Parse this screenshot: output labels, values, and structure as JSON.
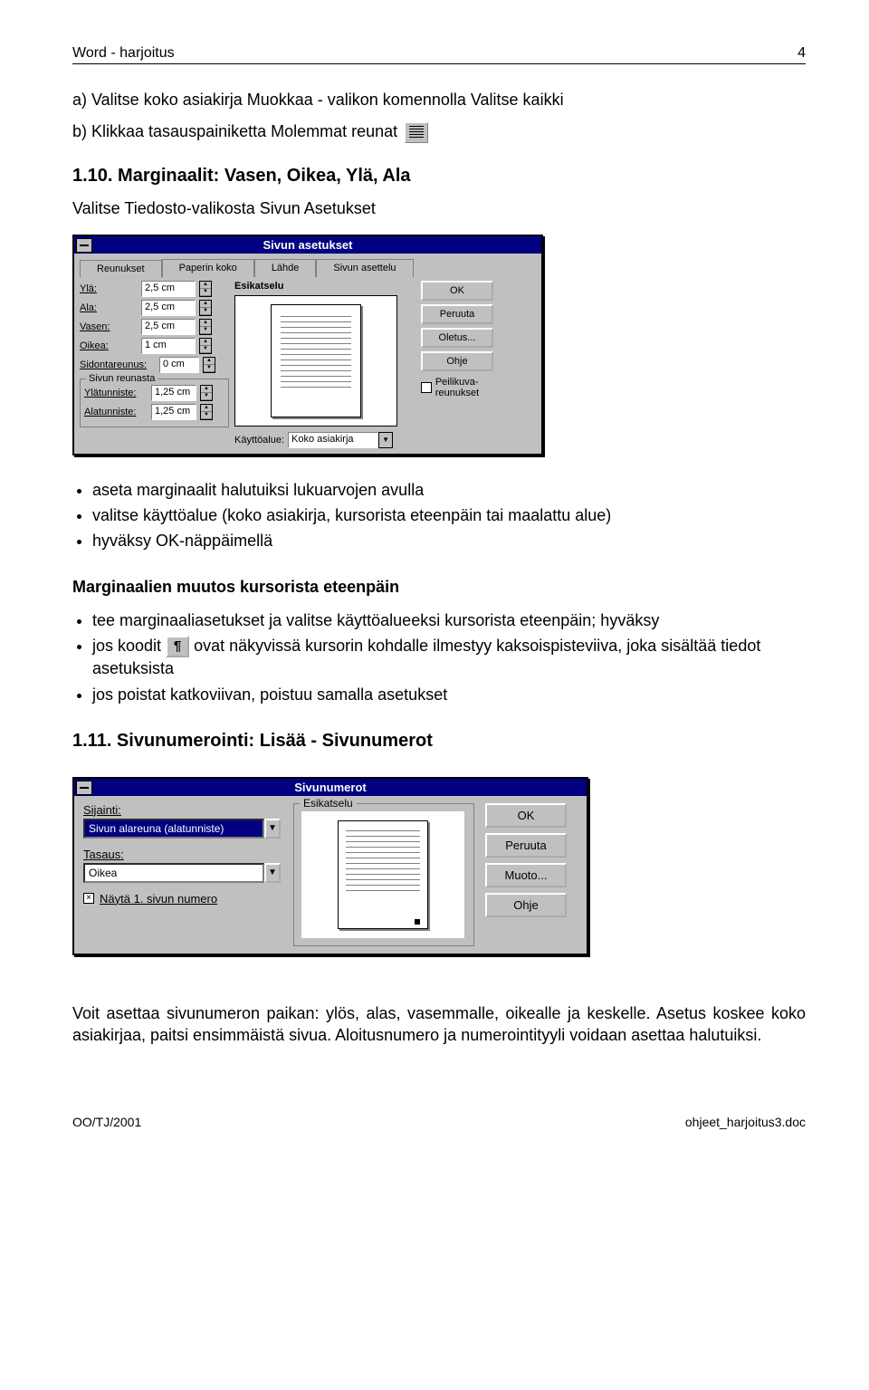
{
  "header": {
    "left": "Word - harjoitus",
    "right": "4"
  },
  "step_a": "a) Valitse koko asiakirja Muokkaa - valikon komennolla Valitse kaikki",
  "step_b": "b) Klikkaa tasauspainiketta Molemmat reunat",
  "sec1_title": "1.10. Marginaalit: Vasen, Oikea, Ylä, Ala",
  "sec1_sub": "Valitse Tiedosto-valikosta Sivun Asetukset",
  "dialog1": {
    "title": "Sivun asetukset",
    "tabs": [
      "Reunukset",
      "Paperin koko",
      "Lähde",
      "Sivun asettelu"
    ],
    "fields": {
      "yla": {
        "label": "Ylä:",
        "value": "2,5 cm"
      },
      "ala": {
        "label": "Ala:",
        "value": "2,5 cm"
      },
      "vasen": {
        "label": "Vasen:",
        "value": "2,5 cm"
      },
      "oikea": {
        "label": "Oikea:",
        "value": "1 cm"
      },
      "sidonta": {
        "label": "Sidontareunus:",
        "value": "0 cm"
      }
    },
    "reunasta_legend": "Sivun reunasta",
    "ylatunniste": {
      "label": "Ylätunniste:",
      "value": "1,25 cm"
    },
    "alatunniste": {
      "label": "Alatunniste:",
      "value": "1,25 cm"
    },
    "esikatselu": "Esikatselu",
    "kayttoalue_label": "Käyttöalue:",
    "kayttoalue_value": "Koko asiakirja",
    "buttons": {
      "ok": "OK",
      "peruuta": "Peruuta",
      "oletus": "Oletus...",
      "ohje": "Ohje"
    },
    "peilikuva": "Peilikuva-reunukset"
  },
  "bullets1": [
    "aseta marginaalit halutuiksi lukuarvojen avulla",
    "valitse käyttöalue (koko asiakirja, kursorista eteenpäin tai maalattu alue)",
    "hyväksy OK-näppäimellä"
  ],
  "marg_heading": "Marginaalien muutos kursorista eteenpäin",
  "bullets2": {
    "b1": "tee marginaaliasetukset ja valitse käyttöalueeksi kursorista eteenpäin; hyväksy",
    "b2a": "jos koodit ",
    "b2b": "ovat näkyvissä kursorin kohdalle ilmestyy kaksoispisteviiva, joka sisältää tiedot asetuksista",
    "b3": "jos poistat katkoviivan, poistuu samalla asetukset"
  },
  "sec2_title": "1.11. Sivunumerointi: Lisää - Sivunumerot",
  "dialog2": {
    "title": "Sivunumerot",
    "sijainti_label": "Sijainti:",
    "sijainti_value": "Sivun alareuna (alatunniste)",
    "tasaus_label": "Tasaus:",
    "tasaus_value": "Oikea",
    "nayta": "Näytä 1. sivun numero",
    "esikatselu": "Esikatselu",
    "buttons": {
      "ok": "OK",
      "peruuta": "Peruuta",
      "muoto": "Muoto...",
      "ohje": "Ohje"
    }
  },
  "body_para": "Voit asettaa sivunumeron paikan: ylös, alas, vasemmalle, oikealle ja keskelle. Asetus koskee koko asiakirjaa, paitsi ensimmäistä sivua. Aloitusnumero ja numerointityyli voidaan asettaa halutuiksi.",
  "footer": {
    "left": "OO/TJ/2001",
    "right": "ohjeet_harjoitus3.doc"
  }
}
